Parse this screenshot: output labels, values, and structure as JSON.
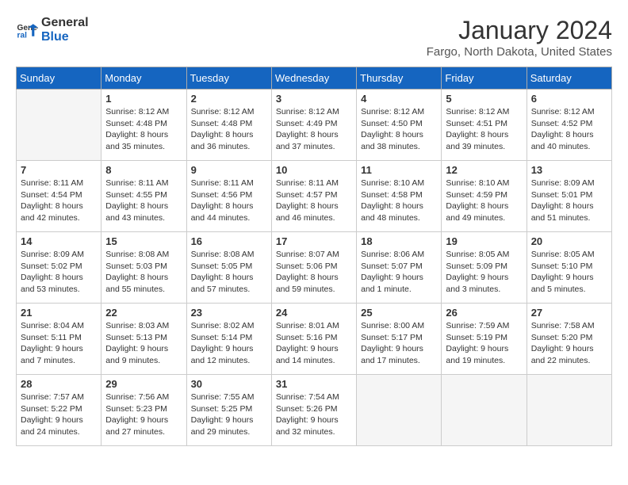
{
  "header": {
    "logo_line1": "General",
    "logo_line2": "Blue",
    "month_title": "January 2024",
    "location": "Fargo, North Dakota, United States"
  },
  "weekdays": [
    "Sunday",
    "Monday",
    "Tuesday",
    "Wednesday",
    "Thursday",
    "Friday",
    "Saturday"
  ],
  "weeks": [
    [
      {
        "day": "",
        "sunrise": "",
        "sunset": "",
        "daylight": ""
      },
      {
        "day": "1",
        "sunrise": "Sunrise: 8:12 AM",
        "sunset": "Sunset: 4:48 PM",
        "daylight": "Daylight: 8 hours and 35 minutes."
      },
      {
        "day": "2",
        "sunrise": "Sunrise: 8:12 AM",
        "sunset": "Sunset: 4:48 PM",
        "daylight": "Daylight: 8 hours and 36 minutes."
      },
      {
        "day": "3",
        "sunrise": "Sunrise: 8:12 AM",
        "sunset": "Sunset: 4:49 PM",
        "daylight": "Daylight: 8 hours and 37 minutes."
      },
      {
        "day": "4",
        "sunrise": "Sunrise: 8:12 AM",
        "sunset": "Sunset: 4:50 PM",
        "daylight": "Daylight: 8 hours and 38 minutes."
      },
      {
        "day": "5",
        "sunrise": "Sunrise: 8:12 AM",
        "sunset": "Sunset: 4:51 PM",
        "daylight": "Daylight: 8 hours and 39 minutes."
      },
      {
        "day": "6",
        "sunrise": "Sunrise: 8:12 AM",
        "sunset": "Sunset: 4:52 PM",
        "daylight": "Daylight: 8 hours and 40 minutes."
      }
    ],
    [
      {
        "day": "7",
        "sunrise": "Sunrise: 8:11 AM",
        "sunset": "Sunset: 4:54 PM",
        "daylight": "Daylight: 8 hours and 42 minutes."
      },
      {
        "day": "8",
        "sunrise": "Sunrise: 8:11 AM",
        "sunset": "Sunset: 4:55 PM",
        "daylight": "Daylight: 8 hours and 43 minutes."
      },
      {
        "day": "9",
        "sunrise": "Sunrise: 8:11 AM",
        "sunset": "Sunset: 4:56 PM",
        "daylight": "Daylight: 8 hours and 44 minutes."
      },
      {
        "day": "10",
        "sunrise": "Sunrise: 8:11 AM",
        "sunset": "Sunset: 4:57 PM",
        "daylight": "Daylight: 8 hours and 46 minutes."
      },
      {
        "day": "11",
        "sunrise": "Sunrise: 8:10 AM",
        "sunset": "Sunset: 4:58 PM",
        "daylight": "Daylight: 8 hours and 48 minutes."
      },
      {
        "day": "12",
        "sunrise": "Sunrise: 8:10 AM",
        "sunset": "Sunset: 4:59 PM",
        "daylight": "Daylight: 8 hours and 49 minutes."
      },
      {
        "day": "13",
        "sunrise": "Sunrise: 8:09 AM",
        "sunset": "Sunset: 5:01 PM",
        "daylight": "Daylight: 8 hours and 51 minutes."
      }
    ],
    [
      {
        "day": "14",
        "sunrise": "Sunrise: 8:09 AM",
        "sunset": "Sunset: 5:02 PM",
        "daylight": "Daylight: 8 hours and 53 minutes."
      },
      {
        "day": "15",
        "sunrise": "Sunrise: 8:08 AM",
        "sunset": "Sunset: 5:03 PM",
        "daylight": "Daylight: 8 hours and 55 minutes."
      },
      {
        "day": "16",
        "sunrise": "Sunrise: 8:08 AM",
        "sunset": "Sunset: 5:05 PM",
        "daylight": "Daylight: 8 hours and 57 minutes."
      },
      {
        "day": "17",
        "sunrise": "Sunrise: 8:07 AM",
        "sunset": "Sunset: 5:06 PM",
        "daylight": "Daylight: 8 hours and 59 minutes."
      },
      {
        "day": "18",
        "sunrise": "Sunrise: 8:06 AM",
        "sunset": "Sunset: 5:07 PM",
        "daylight": "Daylight: 9 hours and 1 minute."
      },
      {
        "day": "19",
        "sunrise": "Sunrise: 8:05 AM",
        "sunset": "Sunset: 5:09 PM",
        "daylight": "Daylight: 9 hours and 3 minutes."
      },
      {
        "day": "20",
        "sunrise": "Sunrise: 8:05 AM",
        "sunset": "Sunset: 5:10 PM",
        "daylight": "Daylight: 9 hours and 5 minutes."
      }
    ],
    [
      {
        "day": "21",
        "sunrise": "Sunrise: 8:04 AM",
        "sunset": "Sunset: 5:11 PM",
        "daylight": "Daylight: 9 hours and 7 minutes."
      },
      {
        "day": "22",
        "sunrise": "Sunrise: 8:03 AM",
        "sunset": "Sunset: 5:13 PM",
        "daylight": "Daylight: 9 hours and 9 minutes."
      },
      {
        "day": "23",
        "sunrise": "Sunrise: 8:02 AM",
        "sunset": "Sunset: 5:14 PM",
        "daylight": "Daylight: 9 hours and 12 minutes."
      },
      {
        "day": "24",
        "sunrise": "Sunrise: 8:01 AM",
        "sunset": "Sunset: 5:16 PM",
        "daylight": "Daylight: 9 hours and 14 minutes."
      },
      {
        "day": "25",
        "sunrise": "Sunrise: 8:00 AM",
        "sunset": "Sunset: 5:17 PM",
        "daylight": "Daylight: 9 hours and 17 minutes."
      },
      {
        "day": "26",
        "sunrise": "Sunrise: 7:59 AM",
        "sunset": "Sunset: 5:19 PM",
        "daylight": "Daylight: 9 hours and 19 minutes."
      },
      {
        "day": "27",
        "sunrise": "Sunrise: 7:58 AM",
        "sunset": "Sunset: 5:20 PM",
        "daylight": "Daylight: 9 hours and 22 minutes."
      }
    ],
    [
      {
        "day": "28",
        "sunrise": "Sunrise: 7:57 AM",
        "sunset": "Sunset: 5:22 PM",
        "daylight": "Daylight: 9 hours and 24 minutes."
      },
      {
        "day": "29",
        "sunrise": "Sunrise: 7:56 AM",
        "sunset": "Sunset: 5:23 PM",
        "daylight": "Daylight: 9 hours and 27 minutes."
      },
      {
        "day": "30",
        "sunrise": "Sunrise: 7:55 AM",
        "sunset": "Sunset: 5:25 PM",
        "daylight": "Daylight: 9 hours and 29 minutes."
      },
      {
        "day": "31",
        "sunrise": "Sunrise: 7:54 AM",
        "sunset": "Sunset: 5:26 PM",
        "daylight": "Daylight: 9 hours and 32 minutes."
      },
      {
        "day": "",
        "sunrise": "",
        "sunset": "",
        "daylight": ""
      },
      {
        "day": "",
        "sunrise": "",
        "sunset": "",
        "daylight": ""
      },
      {
        "day": "",
        "sunrise": "",
        "sunset": "",
        "daylight": ""
      }
    ]
  ]
}
